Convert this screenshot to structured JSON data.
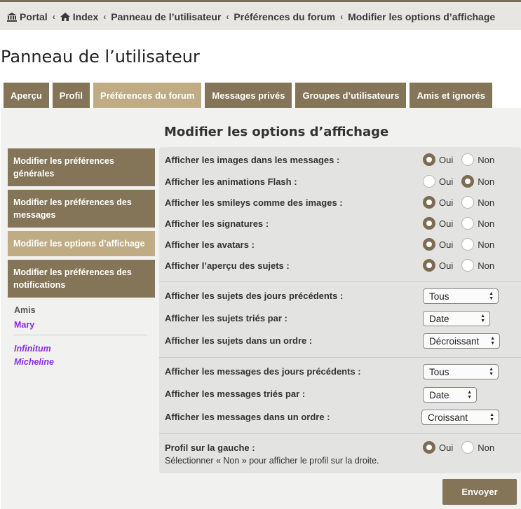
{
  "breadcrumbs": [
    {
      "label": "Portal",
      "icon": "institution-icon"
    },
    {
      "label": "Index",
      "icon": "home-icon"
    },
    {
      "label": "Panneau de l’utilisateur"
    },
    {
      "label": "Préférences du forum"
    },
    {
      "label": "Modifier les options d’affichage"
    }
  ],
  "page_title": "Panneau de l’utilisateur",
  "tabs": [
    {
      "label": "Aperçu",
      "active": false
    },
    {
      "label": "Profil",
      "active": false
    },
    {
      "label": "Préférences du forum",
      "active": true
    },
    {
      "label": "Messages privés",
      "active": false
    },
    {
      "label": "Groupes d’utilisateurs",
      "active": false
    },
    {
      "label": "Amis et ignorés",
      "active": false
    }
  ],
  "section_title": "Modifier les options d’affichage",
  "sidenav": [
    {
      "label": "Modifier les préférences générales",
      "active": false
    },
    {
      "label": "Modifier les préférences des messages",
      "active": false
    },
    {
      "label": "Modifier les options d’affichage",
      "active": true
    },
    {
      "label": "Modifier les préférences des notifications",
      "active": false
    }
  ],
  "friends": {
    "heading": "Amis",
    "online": [
      "Mary"
    ],
    "offline": [
      "Infinitum",
      "Micheline"
    ]
  },
  "radio_labels": {
    "yes": "Oui",
    "no": "Non"
  },
  "options": [
    {
      "label": "Afficher les images dans les messages :",
      "value": "Oui"
    },
    {
      "label": "Afficher les animations Flash :",
      "value": "Non"
    },
    {
      "label": "Afficher les smileys comme des images :",
      "value": "Oui"
    },
    {
      "label": "Afficher les signatures :",
      "value": "Oui"
    },
    {
      "label": "Afficher les avatars :",
      "value": "Oui"
    },
    {
      "label": "Afficher l’aperçu des sujets :",
      "value": "Oui"
    }
  ],
  "topic_selects": [
    {
      "label": "Afficher les sujets des jours précédents :",
      "value": "Tous"
    },
    {
      "label": "Afficher les sujets triés par :",
      "value": "Date"
    },
    {
      "label": "Afficher les sujets dans un ordre :",
      "value": "Décroissant"
    }
  ],
  "post_selects": [
    {
      "label": "Afficher les messages des jours précédents :",
      "value": "Tous"
    },
    {
      "label": "Afficher les messages triés par :",
      "value": "Date"
    },
    {
      "label": "Afficher les messages dans un ordre :",
      "value": "Croissant"
    }
  ],
  "profile_left": {
    "label": "Profil sur la gauche :",
    "value": "Oui",
    "hint": "Sélectionner « Non » pour afficher le profil sur la droite."
  },
  "submit_label": "Envoyer",
  "colors": {
    "accent": "#847458",
    "accent_active": "#bfac85",
    "friend_link": "#8a2be2"
  }
}
